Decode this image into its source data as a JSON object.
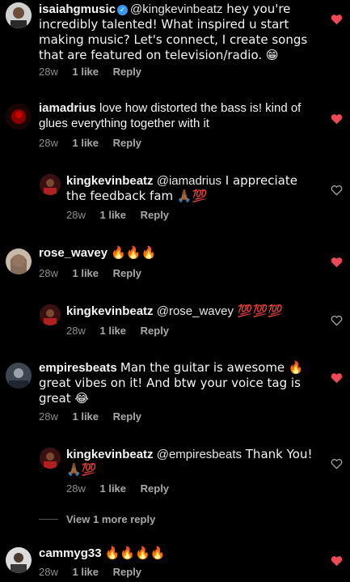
{
  "icons": {
    "heart_filled": "heart-filled-icon",
    "heart_outline": "heart-outline-icon",
    "verified": "verified-badge-icon"
  },
  "colors": {
    "heart": "#ed4956",
    "background": "#000000",
    "muted": "#8e8e8e"
  },
  "comments": [
    {
      "username": "isaiahgmusic",
      "verified": true,
      "mention": "@kingkevinbeatz",
      "text": " hey you're incredibly talented! What inspired u start making music? Let's connect, I create songs that are featured on television/radio. 😁",
      "time": "28w",
      "likes": "1 like",
      "reply": "Reply",
      "liked": true
    },
    {
      "username": "iamadrius",
      "text": "love how distorted the bass is! kind of glues everything together with it",
      "time": "28w",
      "likes": "1 like",
      "reply": "Reply",
      "liked": true
    },
    {
      "username": "kingkevinbeatz",
      "mention": "@iamadrius",
      "text": " I appreciate the feedback fam 🙏🏾💯",
      "time": "28w",
      "likes": "1 like",
      "reply": "Reply",
      "liked": false
    },
    {
      "username": "rose_wavey",
      "text": "🔥🔥🔥",
      "time": "28w",
      "likes": "1 like",
      "reply": "Reply",
      "liked": true
    },
    {
      "username": "kingkevinbeatz",
      "mention": "@rose_wavey",
      "text": " 💯💯💯",
      "time": "28w",
      "likes": "1 like",
      "reply": "Reply",
      "liked": false
    },
    {
      "username": "empiresbeats",
      "text": "Man the guitar is awesome 🔥 great vibes on it! And btw your voice tag is great 😂",
      "time": "28w",
      "likes": "1 like",
      "reply": "Reply",
      "liked": true
    },
    {
      "username": "kingkevinbeatz",
      "mention": "@empiresbeats",
      "text": " Thank You! 🙏🏾💯",
      "time": "28w",
      "likes": "1 like",
      "reply": "Reply",
      "liked": false
    },
    {
      "username": "cammyg33",
      "text": "🔥🔥🔥🔥",
      "time": "28w",
      "likes": "1 like",
      "reply": "Reply",
      "liked": true
    }
  ],
  "view_more": "View 1 more reply"
}
